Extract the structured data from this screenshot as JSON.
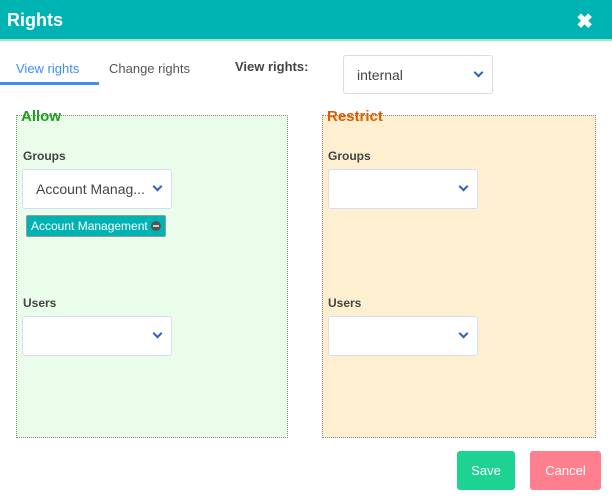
{
  "dialog": {
    "title": "Rights",
    "close_icon": "close-icon"
  },
  "tabs": [
    {
      "label": "View rights",
      "active": true
    },
    {
      "label": "Change rights",
      "active": false
    }
  ],
  "view_rights": {
    "label": "View rights:",
    "value": "internal"
  },
  "allow": {
    "title": "Allow",
    "title_color": "#1ea01e",
    "groups_label": "Groups",
    "groups_value": "Account Manag...",
    "groups_tags": [
      "Account Management"
    ],
    "users_label": "Users",
    "users_value": ""
  },
  "restrict": {
    "title": "Restrict",
    "title_color": "#e05a00",
    "groups_label": "Groups",
    "groups_value": "",
    "users_label": "Users",
    "users_value": ""
  },
  "buttons": {
    "save": "Save",
    "cancel": "Cancel"
  }
}
